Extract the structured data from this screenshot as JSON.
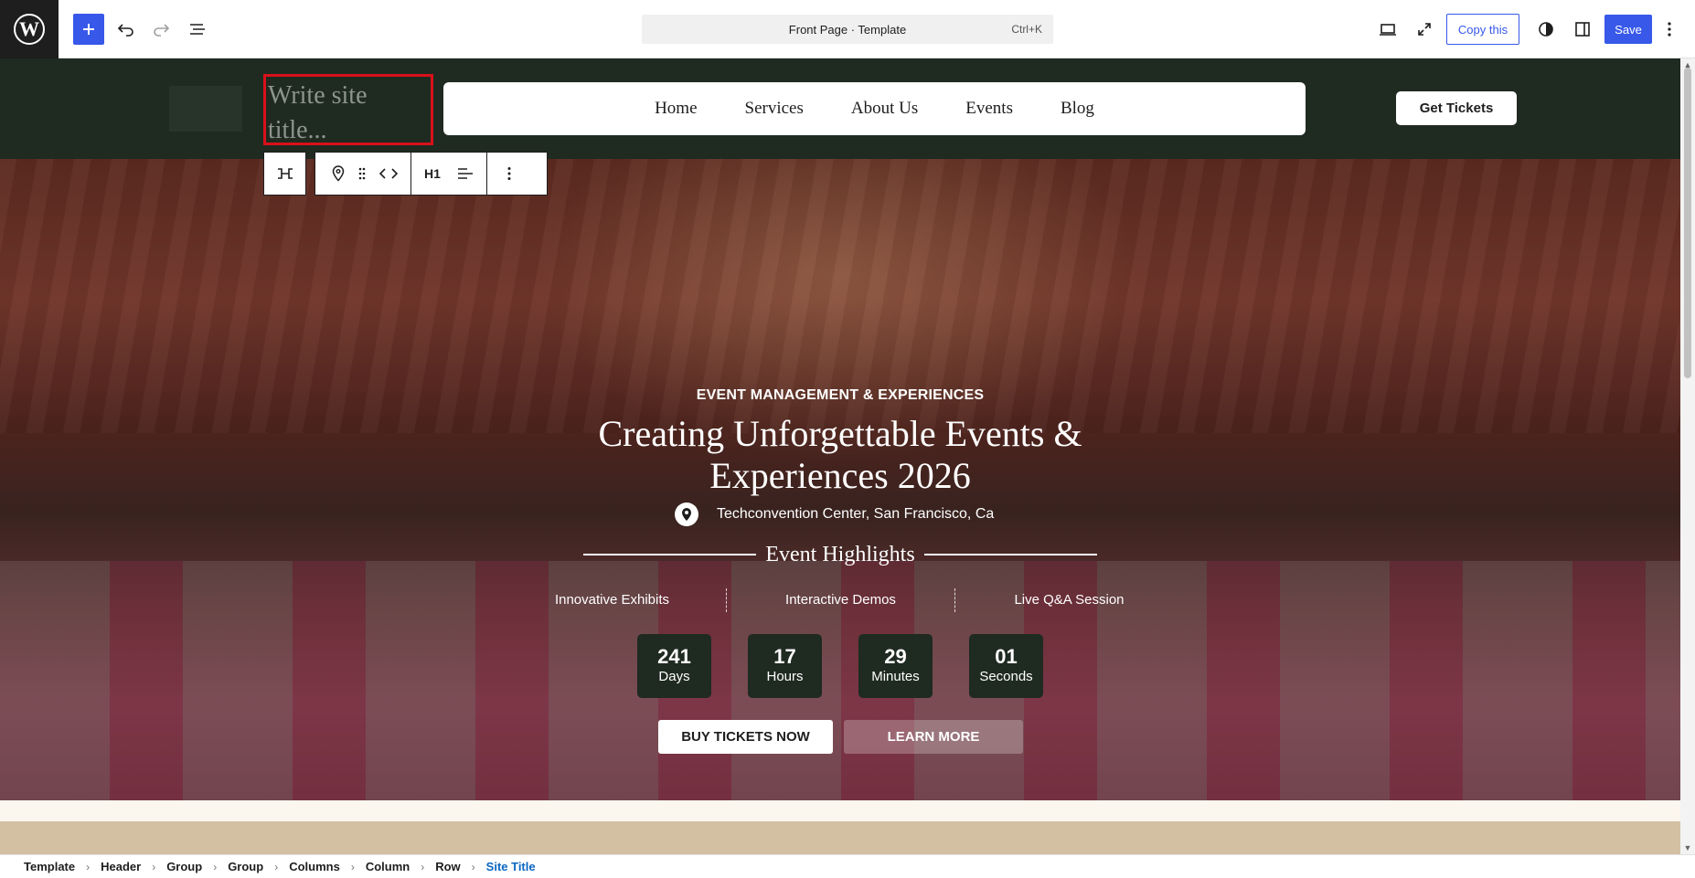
{
  "topbar": {
    "template_label": "Front Page · Template",
    "shortcut": "Ctrl+K",
    "copy_label": "Copy this",
    "save_label": "Save"
  },
  "header": {
    "site_title_placeholder": "Write site title...",
    "nav": [
      "Home",
      "Services",
      "About Us",
      "Events",
      "Blog"
    ],
    "cta": "Get Tickets"
  },
  "block_toolbar": {
    "heading_level": "H1"
  },
  "hero": {
    "kicker": "EVENT MANAGEMENT & EXPERIENCES",
    "title": "Creating Unforgettable Events & Experiences 2026",
    "location": "Techconvention Center, San Francisco, Ca",
    "highlights_title": "Event Highlights",
    "features": [
      "Innovative Exhibits",
      "Interactive Demos",
      "Live Q&A Session"
    ],
    "countdown": [
      {
        "value": "241",
        "label": "Days"
      },
      {
        "value": "17",
        "label": "Hours"
      },
      {
        "value": "29",
        "label": "Minutes"
      },
      {
        "value": "01",
        "label": "Seconds"
      }
    ],
    "buy_label": "BUY TICKETS NOW",
    "learn_label": "LEARN MORE"
  },
  "breadcrumbs": [
    "Template",
    "Header",
    "Group",
    "Group",
    "Columns",
    "Column",
    "Row",
    "Site Title"
  ],
  "colors": {
    "accent": "#3858e9",
    "header_bg": "#1f2a21",
    "selection": "#d9111a",
    "breadcrumb_active": "#0a66c2"
  }
}
